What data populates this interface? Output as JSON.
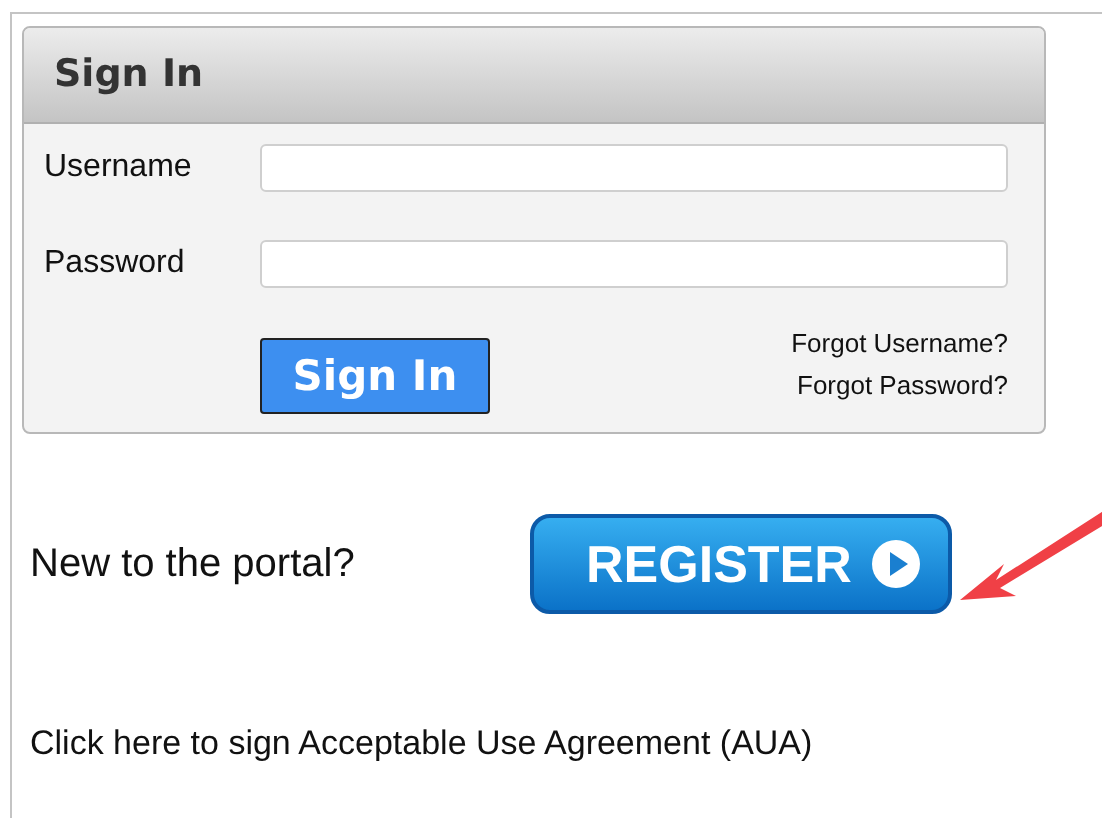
{
  "sign_in_panel": {
    "title": "Sign In",
    "fields": [
      {
        "label": "Username"
      },
      {
        "label": "Password"
      }
    ],
    "submit_button": "Sign In",
    "links": [
      "Forgot Username?",
      "Forgot Password?"
    ]
  },
  "register": {
    "prompt": "New to the portal?",
    "button": "REGISTER"
  },
  "agreement_link": "Click here to sign Acceptable Use Agreement (AUA)"
}
